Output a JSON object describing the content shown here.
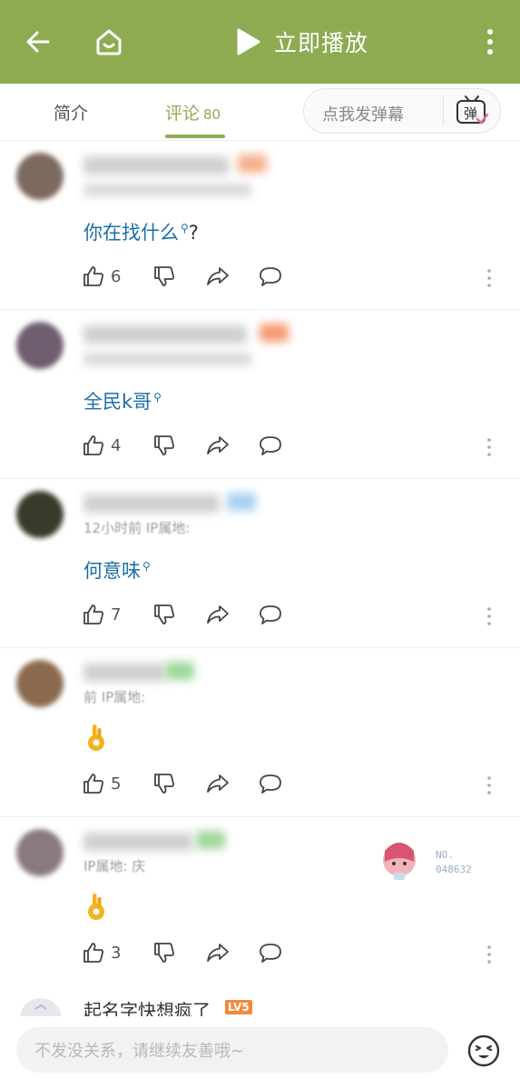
{
  "header": {
    "play_label": "立即播放",
    "accent_color": "#8fab52"
  },
  "tabs": {
    "intro_label": "简介",
    "comments_label": "评论",
    "comments_count": "80"
  },
  "danmaku": {
    "placeholder": "点我发弹幕",
    "icon_text": "弹"
  },
  "comments": [
    {
      "text": "你在找什么",
      "suffix": "?",
      "likes": "6"
    },
    {
      "text": "全民k哥",
      "likes": "4"
    },
    {
      "meta": "12小时前 IP属地:",
      "text": "何意味",
      "likes": "7"
    },
    {
      "meta": "前 IP属地:",
      "emoji": "ok-hand",
      "likes": "5"
    },
    {
      "meta": "IP属地: 庆",
      "emoji": "ok-hand",
      "likes": "3",
      "sticker": {
        "no_label": "NO.",
        "no_value": "048632"
      }
    }
  ],
  "partial_comment": {
    "name": "起名字快想疯了",
    "level": "LV5"
  },
  "composer": {
    "placeholder": "不发没关系，请继续友善哦~"
  }
}
